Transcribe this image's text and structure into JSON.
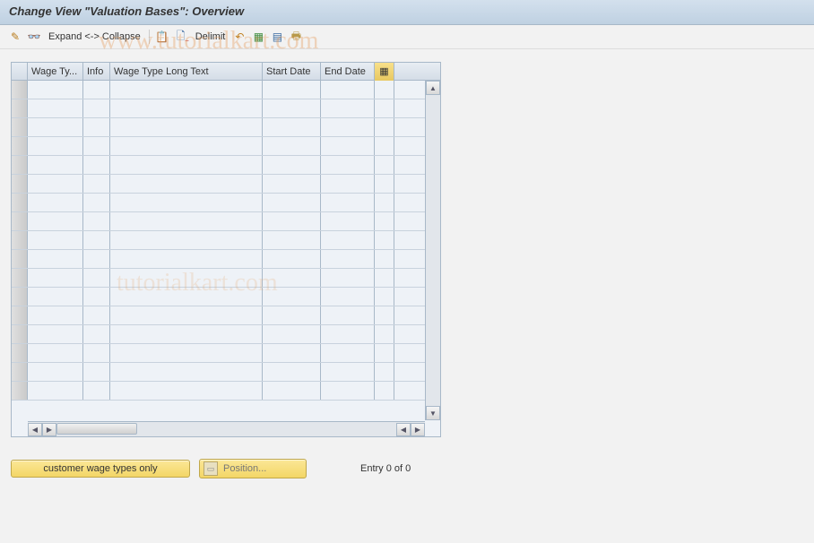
{
  "title": "Change View \"Valuation Bases\": Overview",
  "watermarks": {
    "w1": "www.tutorialkart.com",
    "w2": "tutorialkart.com"
  },
  "toolbar": {
    "expand_label": "Expand <-> Collapse",
    "delimit_label": "Delimit"
  },
  "table": {
    "columns": {
      "wage_type": "Wage Ty...",
      "info": "Info",
      "long_text": "Wage Type Long Text",
      "start_date": "Start Date",
      "end_date": "End Date"
    },
    "rows": [
      {
        "wage_type": "",
        "info": "",
        "long_text": "",
        "start_date": "",
        "end_date": ""
      },
      {
        "wage_type": "",
        "info": "",
        "long_text": "",
        "start_date": "",
        "end_date": ""
      },
      {
        "wage_type": "",
        "info": "",
        "long_text": "",
        "start_date": "",
        "end_date": ""
      },
      {
        "wage_type": "",
        "info": "",
        "long_text": "",
        "start_date": "",
        "end_date": ""
      },
      {
        "wage_type": "",
        "info": "",
        "long_text": "",
        "start_date": "",
        "end_date": ""
      },
      {
        "wage_type": "",
        "info": "",
        "long_text": "",
        "start_date": "",
        "end_date": ""
      },
      {
        "wage_type": "",
        "info": "",
        "long_text": "",
        "start_date": "",
        "end_date": ""
      },
      {
        "wage_type": "",
        "info": "",
        "long_text": "",
        "start_date": "",
        "end_date": ""
      },
      {
        "wage_type": "",
        "info": "",
        "long_text": "",
        "start_date": "",
        "end_date": ""
      },
      {
        "wage_type": "",
        "info": "",
        "long_text": "",
        "start_date": "",
        "end_date": ""
      },
      {
        "wage_type": "",
        "info": "",
        "long_text": "",
        "start_date": "",
        "end_date": ""
      },
      {
        "wage_type": "",
        "info": "",
        "long_text": "",
        "start_date": "",
        "end_date": ""
      },
      {
        "wage_type": "",
        "info": "",
        "long_text": "",
        "start_date": "",
        "end_date": ""
      },
      {
        "wage_type": "",
        "info": "",
        "long_text": "",
        "start_date": "",
        "end_date": ""
      },
      {
        "wage_type": "",
        "info": "",
        "long_text": "",
        "start_date": "",
        "end_date": ""
      },
      {
        "wage_type": "",
        "info": "",
        "long_text": "",
        "start_date": "",
        "end_date": ""
      },
      {
        "wage_type": "",
        "info": "",
        "long_text": "",
        "start_date": "",
        "end_date": ""
      }
    ]
  },
  "footer": {
    "customer_wage_label": "customer wage types only",
    "position_label": "Position...",
    "entry_text": "Entry 0 of 0"
  }
}
